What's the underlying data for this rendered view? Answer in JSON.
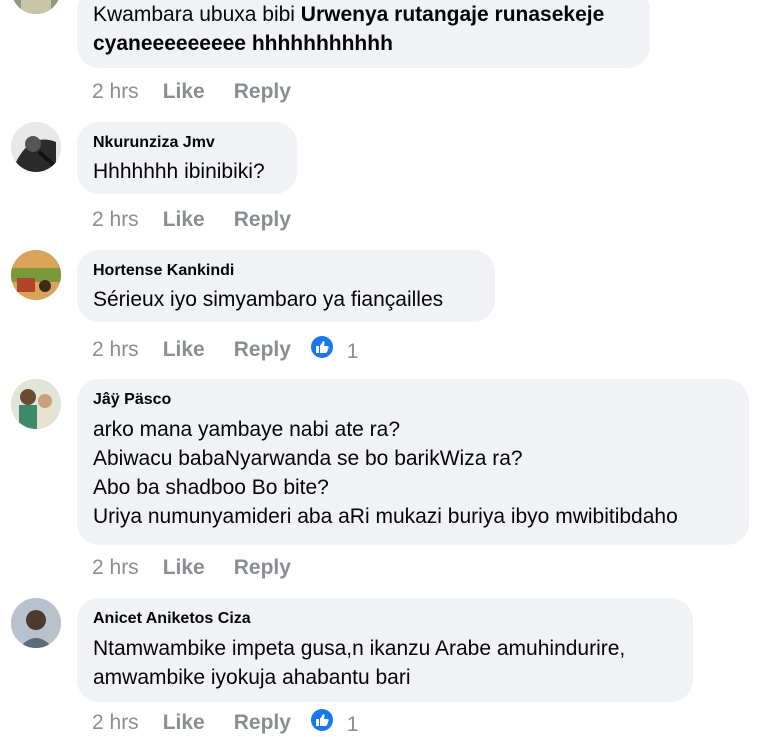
{
  "comments": [
    {
      "author": "",
      "lines_plain": [
        "Kwambara ubuxa bibi ",
        ""
      ],
      "line1_bold": "Urwenya rutangaje runasekeje",
      "line2_bold": "cyaneeeeeeeee hhhhhhhhhhh",
      "time": "2 hrs",
      "like": "Like",
      "reply": "Reply",
      "reactions": ""
    },
    {
      "author": "Nkurunziza Jmv",
      "lines": [
        "Hhhhhhh ibinibiki?"
      ],
      "time": "2 hrs",
      "like": "Like",
      "reply": "Reply",
      "reactions": ""
    },
    {
      "author": "Hortense Kankindi",
      "lines": [
        "Sérieux iyo simyambaro ya fiançailles"
      ],
      "time": "2 hrs",
      "like": "Like",
      "reply": "Reply",
      "reactions": "1"
    },
    {
      "author": "Jâÿ Päsco",
      "lines": [
        "arko mana yambaye nabi ate ra?",
        "Abiwacu babaNyarwanda se bo barikWiza ra?",
        "Abo ba shadboo Bo bite?",
        "Uriya numunyamideri aba aRi mukazi buriya ibyo mwibitibdaho"
      ],
      "time": "2 hrs",
      "like": "Like",
      "reply": "Reply",
      "reactions": ""
    },
    {
      "author": "Anicet Aniketos Ciza",
      "lines": [
        "Ntamwambike impeta gusa,n ikanzu Arabe amuhindurire,",
        "amwambike iyokuja ahabantu bari"
      ],
      "time": "2 hrs",
      "like": "Like",
      "reply": "Reply",
      "reactions": "1"
    }
  ],
  "colors": {
    "bubble": "#f0f2f5",
    "meta": "#8a8d91",
    "like_badge": "#1877f2"
  }
}
